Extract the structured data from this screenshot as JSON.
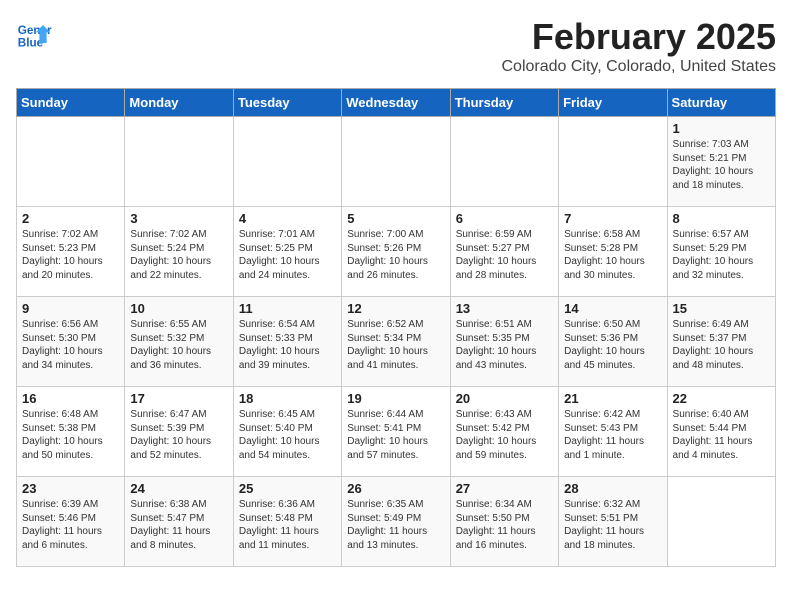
{
  "logo": {
    "line1": "General",
    "line2": "Blue"
  },
  "header": {
    "month_year": "February 2025",
    "location": "Colorado City, Colorado, United States"
  },
  "days_of_week": [
    "Sunday",
    "Monday",
    "Tuesday",
    "Wednesday",
    "Thursday",
    "Friday",
    "Saturday"
  ],
  "weeks": [
    [
      {
        "day": "",
        "content": ""
      },
      {
        "day": "",
        "content": ""
      },
      {
        "day": "",
        "content": ""
      },
      {
        "day": "",
        "content": ""
      },
      {
        "day": "",
        "content": ""
      },
      {
        "day": "",
        "content": ""
      },
      {
        "day": "1",
        "content": "Sunrise: 7:03 AM\nSunset: 5:21 PM\nDaylight: 10 hours\nand 18 minutes."
      }
    ],
    [
      {
        "day": "2",
        "content": "Sunrise: 7:02 AM\nSunset: 5:23 PM\nDaylight: 10 hours\nand 20 minutes."
      },
      {
        "day": "3",
        "content": "Sunrise: 7:02 AM\nSunset: 5:24 PM\nDaylight: 10 hours\nand 22 minutes."
      },
      {
        "day": "4",
        "content": "Sunrise: 7:01 AM\nSunset: 5:25 PM\nDaylight: 10 hours\nand 24 minutes."
      },
      {
        "day": "5",
        "content": "Sunrise: 7:00 AM\nSunset: 5:26 PM\nDaylight: 10 hours\nand 26 minutes."
      },
      {
        "day": "6",
        "content": "Sunrise: 6:59 AM\nSunset: 5:27 PM\nDaylight: 10 hours\nand 28 minutes."
      },
      {
        "day": "7",
        "content": "Sunrise: 6:58 AM\nSunset: 5:28 PM\nDaylight: 10 hours\nand 30 minutes."
      },
      {
        "day": "8",
        "content": "Sunrise: 6:57 AM\nSunset: 5:29 PM\nDaylight: 10 hours\nand 32 minutes."
      }
    ],
    [
      {
        "day": "9",
        "content": "Sunrise: 6:56 AM\nSunset: 5:30 PM\nDaylight: 10 hours\nand 34 minutes."
      },
      {
        "day": "10",
        "content": "Sunrise: 6:55 AM\nSunset: 5:32 PM\nDaylight: 10 hours\nand 36 minutes."
      },
      {
        "day": "11",
        "content": "Sunrise: 6:54 AM\nSunset: 5:33 PM\nDaylight: 10 hours\nand 39 minutes."
      },
      {
        "day": "12",
        "content": "Sunrise: 6:52 AM\nSunset: 5:34 PM\nDaylight: 10 hours\nand 41 minutes."
      },
      {
        "day": "13",
        "content": "Sunrise: 6:51 AM\nSunset: 5:35 PM\nDaylight: 10 hours\nand 43 minutes."
      },
      {
        "day": "14",
        "content": "Sunrise: 6:50 AM\nSunset: 5:36 PM\nDaylight: 10 hours\nand 45 minutes."
      },
      {
        "day": "15",
        "content": "Sunrise: 6:49 AM\nSunset: 5:37 PM\nDaylight: 10 hours\nand 48 minutes."
      }
    ],
    [
      {
        "day": "16",
        "content": "Sunrise: 6:48 AM\nSunset: 5:38 PM\nDaylight: 10 hours\nand 50 minutes."
      },
      {
        "day": "17",
        "content": "Sunrise: 6:47 AM\nSunset: 5:39 PM\nDaylight: 10 hours\nand 52 minutes."
      },
      {
        "day": "18",
        "content": "Sunrise: 6:45 AM\nSunset: 5:40 PM\nDaylight: 10 hours\nand 54 minutes."
      },
      {
        "day": "19",
        "content": "Sunrise: 6:44 AM\nSunset: 5:41 PM\nDaylight: 10 hours\nand 57 minutes."
      },
      {
        "day": "20",
        "content": "Sunrise: 6:43 AM\nSunset: 5:42 PM\nDaylight: 10 hours\nand 59 minutes."
      },
      {
        "day": "21",
        "content": "Sunrise: 6:42 AM\nSunset: 5:43 PM\nDaylight: 11 hours\nand 1 minute."
      },
      {
        "day": "22",
        "content": "Sunrise: 6:40 AM\nSunset: 5:44 PM\nDaylight: 11 hours\nand 4 minutes."
      }
    ],
    [
      {
        "day": "23",
        "content": "Sunrise: 6:39 AM\nSunset: 5:46 PM\nDaylight: 11 hours\nand 6 minutes."
      },
      {
        "day": "24",
        "content": "Sunrise: 6:38 AM\nSunset: 5:47 PM\nDaylight: 11 hours\nand 8 minutes."
      },
      {
        "day": "25",
        "content": "Sunrise: 6:36 AM\nSunset: 5:48 PM\nDaylight: 11 hours\nand 11 minutes."
      },
      {
        "day": "26",
        "content": "Sunrise: 6:35 AM\nSunset: 5:49 PM\nDaylight: 11 hours\nand 13 minutes."
      },
      {
        "day": "27",
        "content": "Sunrise: 6:34 AM\nSunset: 5:50 PM\nDaylight: 11 hours\nand 16 minutes."
      },
      {
        "day": "28",
        "content": "Sunrise: 6:32 AM\nSunset: 5:51 PM\nDaylight: 11 hours\nand 18 minutes."
      },
      {
        "day": "",
        "content": ""
      }
    ]
  ]
}
